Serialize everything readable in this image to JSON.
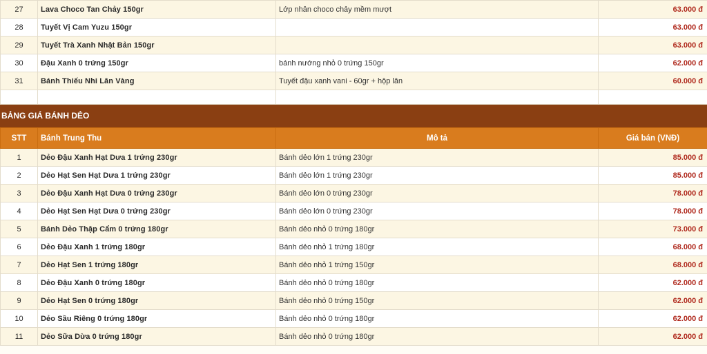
{
  "table1": {
    "rows": [
      {
        "stt": "27",
        "name": "Lava Choco Tan Chảy 150gr",
        "desc": "Lớp nhân choco chảy mềm mượt",
        "price": "63.000 đ"
      },
      {
        "stt": "28",
        "name": "Tuyết Vị Cam Yuzu 150gr",
        "desc": "",
        "price": "63.000 đ"
      },
      {
        "stt": "29",
        "name": "Tuyết Trà Xanh Nhật Bản 150gr",
        "desc": "",
        "price": "63.000 đ"
      },
      {
        "stt": "30",
        "name": "Đậu Xanh 0 trứng 150gr",
        "desc": "bánh nướng nhỏ 0 trứng 150gr",
        "price": "62.000 đ"
      },
      {
        "stt": "31",
        "name": "Bánh Thiếu Nhi Lân Vàng",
        "desc": "Tuyết đậu xanh vani - 60gr + hộp lân",
        "price": "60.000 đ"
      }
    ]
  },
  "section2": {
    "title": "BẢNG GIÁ BÁNH DẺO",
    "headers": {
      "stt": "STT",
      "name": "Bánh Trung Thu",
      "desc": "Mô tả",
      "price": "Giá bán (VNĐ)"
    },
    "rows": [
      {
        "stt": "1",
        "name": "Dẻo Đậu Xanh Hạt Dưa 1 trứng 230gr",
        "desc": "Bánh dẻo lớn 1 trứng 230gr",
        "price": "85.000 đ"
      },
      {
        "stt": "2",
        "name": "Dẻo Hạt Sen Hạt Dưa 1 trứng 230gr",
        "desc": "Bánh dẻo lớn 1 trứng 230gr",
        "price": "85.000 đ"
      },
      {
        "stt": "3",
        "name": "Dẻo Đậu Xanh Hạt Dưa 0 trứng 230gr",
        "desc": "Bánh dẻo lớn 0 trứng 230gr",
        "price": "78.000 đ"
      },
      {
        "stt": "4",
        "name": "Dẻo Hạt Sen Hạt Dưa 0 trứng 230gr",
        "desc": "Bánh dẻo lớn 0 trứng 230gr",
        "price": "78.000 đ"
      },
      {
        "stt": "5",
        "name": "Bánh Dẻo Thập Cẩm 0 trứng 180gr",
        "desc": "Bánh dẻo nhỏ 0 trứng 180gr",
        "price": "73.000 đ"
      },
      {
        "stt": "6",
        "name": "Dẻo Đậu Xanh 1 trứng 180gr",
        "desc": "Bánh dẻo nhỏ 1 trứng 180gr",
        "price": "68.000 đ"
      },
      {
        "stt": "7",
        "name": "Dẻo Hạt Sen 1 trứng 180gr",
        "desc": "Bánh dẻo nhỏ 1 trứng 150gr",
        "price": "68.000 đ"
      },
      {
        "stt": "8",
        "name": "Dẻo Đậu Xanh 0 trứng 180gr",
        "desc": "Bánh dẻo nhỏ 0 trứng 180gr",
        "price": "62.000 đ"
      },
      {
        "stt": "9",
        "name": "Dẻo Hạt Sen 0 trứng 180gr",
        "desc": "Bánh dẻo nhỏ 0 trứng 150gr",
        "price": "62.000 đ"
      },
      {
        "stt": "10",
        "name": "Dẻo Sầu Riêng 0 trứng 180gr",
        "desc": "Bánh dẻo nhỏ 0 trứng 180gr",
        "price": "62.000 đ"
      },
      {
        "stt": "11",
        "name": "Dẻo Sữa Dừa 0 trứng 180gr",
        "desc": "Bánh dẻo nhỏ 0 trứng 180gr",
        "price": "62.000 đ"
      }
    ]
  }
}
